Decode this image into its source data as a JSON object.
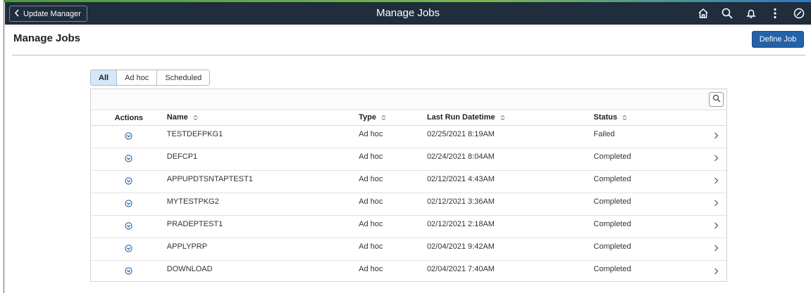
{
  "header": {
    "back_label": "Update Manager",
    "title": "Manage Jobs",
    "icons": [
      "home-icon",
      "search-icon",
      "bell-icon",
      "more-vertical-icon",
      "navbar-icon"
    ],
    "colors": {
      "bar": "#1f2d3d",
      "accent": "#2461a8"
    }
  },
  "page": {
    "title": "Manage Jobs",
    "define_button": "Define Job"
  },
  "filters": {
    "tabs": [
      {
        "label": "All",
        "active": true
      },
      {
        "label": "Ad hoc",
        "active": false
      },
      {
        "label": "Scheduled",
        "active": false
      }
    ]
  },
  "grid": {
    "columns": {
      "actions": "Actions",
      "name": "Name",
      "type": "Type",
      "last_run": "Last Run Datetime",
      "status": "Status"
    },
    "rows": [
      {
        "name": "TESTDEFPKG1",
        "type": "Ad hoc",
        "last_run": "02/25/2021  8:19AM",
        "status": "Failed"
      },
      {
        "name": "DEFCP1",
        "type": "Ad hoc",
        "last_run": "02/24/2021  8:04AM",
        "status": "Completed"
      },
      {
        "name": "APPUPDTSNTAPTEST1",
        "type": "Ad hoc",
        "last_run": "02/12/2021  4:43AM",
        "status": "Completed"
      },
      {
        "name": "MYTESTPKG2",
        "type": "Ad hoc",
        "last_run": "02/12/2021  3:36AM",
        "status": "Completed"
      },
      {
        "name": "PRADEPTEST1",
        "type": "Ad hoc",
        "last_run": "02/12/2021  2:18AM",
        "status": "Completed"
      },
      {
        "name": "APPLYPRP",
        "type": "Ad hoc",
        "last_run": "02/04/2021  9:42AM",
        "status": "Completed"
      },
      {
        "name": "DOWNLOAD",
        "type": "Ad hoc",
        "last_run": "02/04/2021  7:40AM",
        "status": "Completed"
      }
    ]
  }
}
